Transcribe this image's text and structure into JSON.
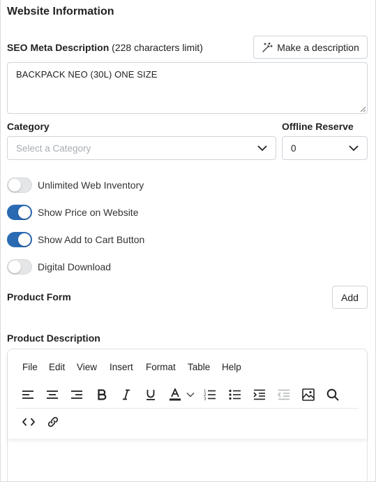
{
  "section": {
    "title": "Website Information"
  },
  "seo": {
    "label": "SEO Meta Description",
    "limit_note": "(228 characters limit)",
    "make_button": "Make a description",
    "value": "BACKPACK NEO (30L) ONE SIZE"
  },
  "category": {
    "label": "Category",
    "placeholder": "Select a Category"
  },
  "offline_reserve": {
    "label": "Offline Reserve",
    "value": "0"
  },
  "toggles": [
    {
      "label": "Unlimited Web Inventory",
      "on": false
    },
    {
      "label": "Show Price on Website",
      "on": true
    },
    {
      "label": "Show Add to Cart Button",
      "on": true
    },
    {
      "label": "Digital Download",
      "on": false
    }
  ],
  "product_form": {
    "label": "Product Form",
    "add_button": "Add"
  },
  "product_description": {
    "label": "Product Description",
    "menu": [
      "File",
      "Edit",
      "View",
      "Insert",
      "Format",
      "Table",
      "Help"
    ]
  },
  "colors": {
    "toggle_on": "#2a6ab3",
    "toggle_off": "#e4e6e8"
  }
}
